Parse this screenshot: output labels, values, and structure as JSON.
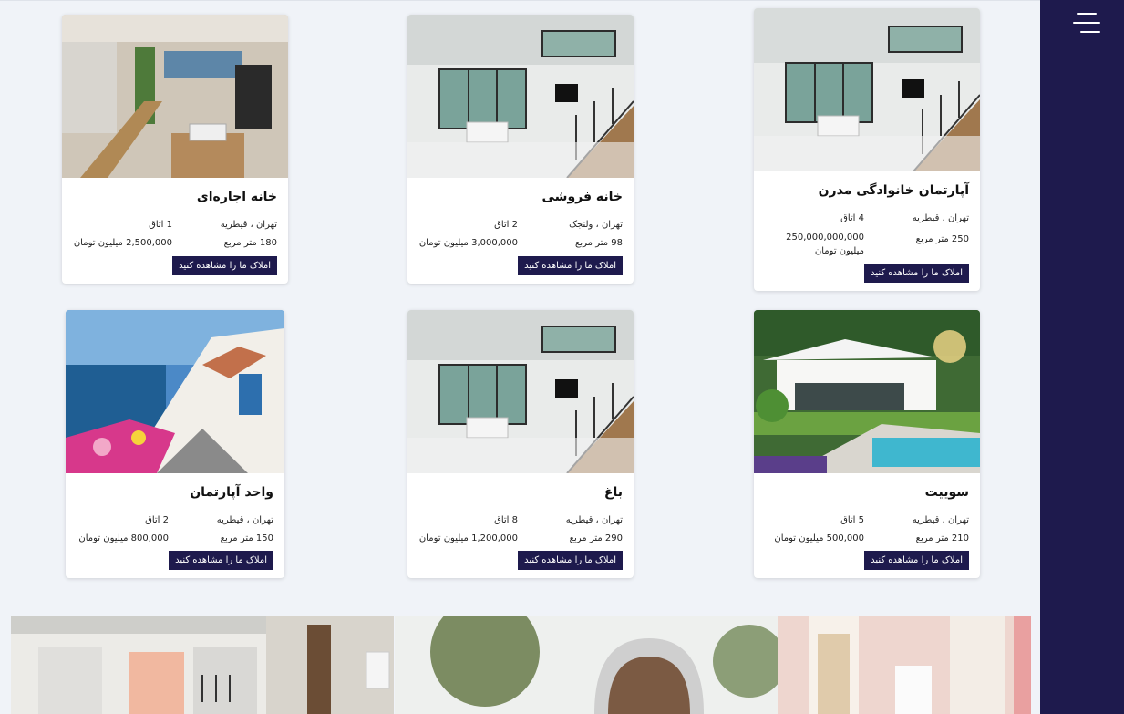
{
  "sidebar": {
    "menu_icon": "hamburger-menu-icon"
  },
  "button_label": "املاک ما را مشاهده کنید",
  "listings": [
    {
      "title": "آپارتمان خانوادگی مدرن",
      "location": "تهران ، قیطریه",
      "rooms": "4 اتاق",
      "area": "250 متر مربع",
      "price": "250,000,000,000 میلیون تومان",
      "button": "املاک ما را مشاهده کنید"
    },
    {
      "title": "خانه فروشی",
      "location": "تهران ، ولنجک",
      "rooms": "2 اتاق",
      "area": "98 متر مربع",
      "price": "3,000,000 میلیون تومان",
      "button": "املاک ما را مشاهده کنید"
    },
    {
      "title": "خانه اجاره‌ای",
      "location": "تهران ، قیطریه",
      "rooms": "1 اتاق",
      "area": "180 متر مربع",
      "price": "2,500,000 میلیون تومان",
      "button": "املاک ما را مشاهده کنید"
    },
    {
      "title": "سوییت",
      "location": "تهران ، قیطریه",
      "rooms": "5 اتاق",
      "area": "210 متر مربع",
      "price": "500,000 میلیون تومان",
      "button": "املاک ما را مشاهده کنید"
    },
    {
      "title": "باغ",
      "location": "تهران ، قیطریه",
      "rooms": "8 اتاق",
      "area": "290 متر مربع",
      "price": "1,200,000 میلیون تومان",
      "button": "املاک ما را مشاهده کنید"
    },
    {
      "title": "واحد آپارتمان",
      "location": "تهران ، قیطریه",
      "rooms": "2 اتاق",
      "area": "150 متر مربع",
      "price": "800,000 میلیون تومان",
      "button": "املاک ما را مشاهده کنید"
    }
  ],
  "colors": {
    "navy": "#1e1a4d",
    "background": "#f0f3f8",
    "card": "#ffffff"
  }
}
